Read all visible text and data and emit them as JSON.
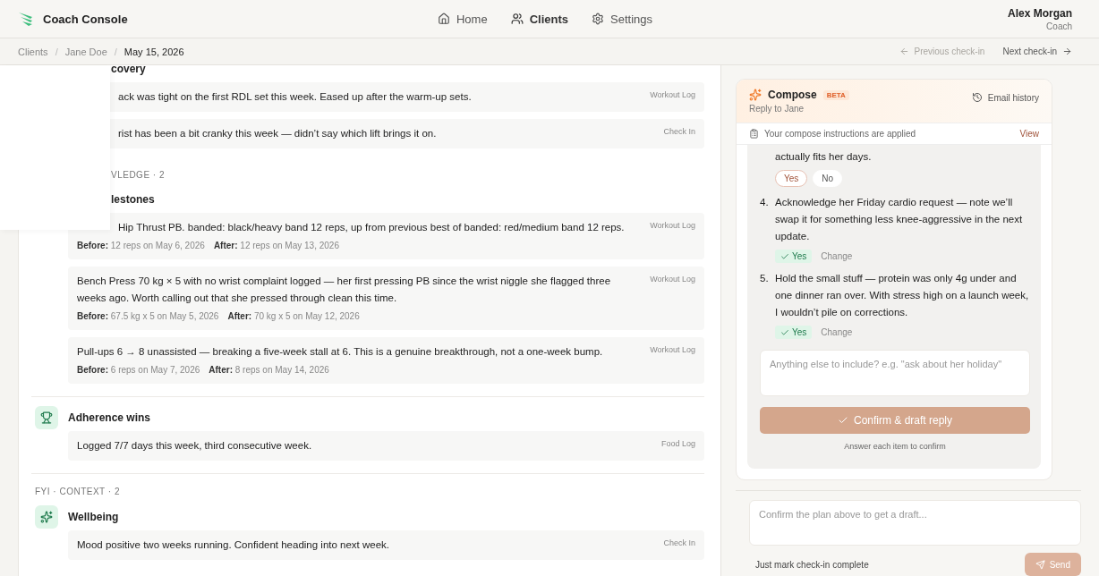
{
  "header": {
    "brand": "Coach Console",
    "nav": [
      {
        "label": "Home",
        "kind": "home",
        "selected": false
      },
      {
        "label": "Clients",
        "kind": "clients",
        "selected": true
      },
      {
        "label": "Settings",
        "kind": "settings",
        "selected": false
      }
    ],
    "user": {
      "name": "Alex Morgan",
      "role": "Coach"
    }
  },
  "breadcrumb": [
    "Clients",
    "Jane Doe",
    "May 15, 2026"
  ],
  "breadcrumb_separator": "/",
  "pager": {
    "previous": {
      "label": "Previous check-in",
      "disabled": true
    },
    "next": {
      "label": "Next check-in",
      "disabled": false
    }
  },
  "groups": [
    {
      "categories": [
        {
          "title": "covery",
          "kind": "plain",
          "cut": true,
          "items": [
            {
              "text": "ack was tight on the first RDL set this week. Eased up after the warm-up sets.",
              "source": "Workout Log",
              "cut": true
            },
            {
              "text": "rist has been a bit cranky this week — didn’t say which lift brings it on.",
              "source": "Check In",
              "cut": true
            }
          ]
        }
      ]
    },
    {
      "label": "VLEDGE",
      "count": "· 2",
      "cut": true,
      "categories": [
        {
          "title": "lestones",
          "kind": "plain",
          "cut": true,
          "items": [
            {
              "text": "Hip Thrust PB. banded: black/heavy band 12 reps, up from previous best of banded: red/medium band 12 reps.",
              "source": "Workout Log",
              "cut": true,
              "before": {
                "label": "Before:",
                "value": "12 reps on May 6, 2026"
              },
              "after": {
                "label": "After:",
                "value": "12 reps on May 13, 2026"
              }
            },
            {
              "text": "Bench Press 70 kg × 5 with no wrist complaint logged — her first pressing PB since the wrist niggle she flagged three weeks ago. Worth calling out that she pressed through clean this time.",
              "source": "Workout Log",
              "cut": false,
              "before": {
                "label": "Before:",
                "value": "67.5 kg x 5 on May 5, 2026"
              },
              "after": {
                "label": "After:",
                "value": "70 kg x 5 on May 12, 2026"
              }
            },
            {
              "text": "Pull-ups 6 → 8 unassisted — breaking a five-week stall at 6. This is a genuine breakthrough, not a one-week bump.",
              "source": "Workout Log",
              "cut": false,
              "before": {
                "label": "Before:",
                "value": "6 reps on May 7, 2026"
              },
              "after": {
                "label": "After:",
                "value": "8 reps on May 14, 2026"
              }
            }
          ]
        },
        {
          "title": "Adherence wins",
          "kind": "trophy",
          "cut": false,
          "items": [
            {
              "text": "Logged 7/7 days this week, third consecutive week.",
              "source": "Food Log",
              "cut": false
            }
          ]
        }
      ]
    },
    {
      "label": "FYI · CONTEXT",
      "count": "· 2",
      "cut": false,
      "categories": [
        {
          "title": "Wellbeing",
          "kind": "sparkle",
          "cut": false,
          "items": [
            {
              "text": "Mood positive two weeks running. Confident heading into next week.",
              "source": "Check In",
              "cut": false
            }
          ]
        }
      ]
    }
  ],
  "compose": {
    "title": "Compose",
    "badge": "BETA",
    "subtitle": "Reply to Jane",
    "history": "Email history",
    "notice": {
      "text": "Your compose instructions are applied",
      "link": "View"
    },
    "items": [
      {
        "kind": "pending",
        "text": "actually fits her days.",
        "options": [
          {
            "label": "Yes",
            "selected": true
          },
          {
            "label": "No",
            "selected": false
          }
        ]
      },
      {
        "kind": "answered",
        "number": "4.",
        "text": "Acknowledge her Friday cardio request — note we’ll swap it for something less knee-aggressive in the next update.",
        "answer": "Yes",
        "action": "Change"
      },
      {
        "kind": "answered",
        "number": "5.",
        "text": "Hold the small stuff — protein was only 4g under and one dinner ran over. With stress high on a launch week, I wouldn’t pile on corrections.",
        "answer": "Yes",
        "action": "Change"
      }
    ],
    "extra_placeholder": "Anything else to include? e.g. \"ask about her holiday\"",
    "confirm": {
      "label": "Confirm & draft reply",
      "disabled": true
    },
    "hint": "Answer each item to confirm"
  },
  "draft": {
    "placeholder": "Confirm the plan above to get a draft...",
    "complete": "Just mark check-in complete",
    "send": {
      "label": "Send",
      "disabled": true
    }
  }
}
